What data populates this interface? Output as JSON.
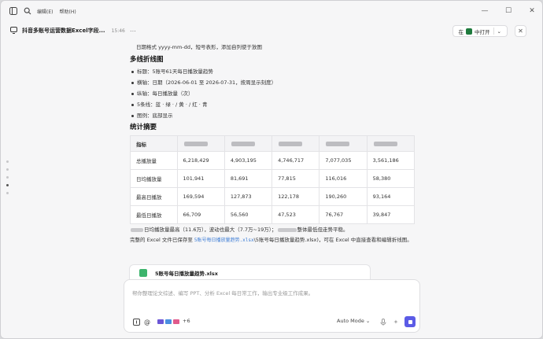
{
  "menu": {
    "edit": "编辑(E)",
    "help": "帮助(H)"
  },
  "chat": {
    "title": "抖音多账号运营数据Excel字段...",
    "time": "15:46",
    "more": "⋯"
  },
  "open_in": {
    "prefix": "在",
    "suffix": "中打开",
    "chevron": "⌄"
  },
  "content": {
    "cut_line": "日期格式 yyyy-mm-dd，短号表形，添加自列使于放图",
    "section_chart": "多线折线图",
    "chart_bullets": [
      "标题：5账号61天每日播放量趋势",
      "横轴：日期（2026-06-01 至 2026-07-31，按周显示刻度）",
      "纵轴：每日播放量（次）",
      "5条线：蓝 · 绿 · / 黄 · / 红 · 青",
      "图例：底部显示"
    ],
    "section_stats": "统计摘要",
    "table_header_first": "指标",
    "table_rows": [
      {
        "label": "总播放量",
        "values": [
          "6,218,429",
          "4,903,195",
          "4,746,717",
          "7,077,035",
          "3,561,186"
        ]
      },
      {
        "label": "日均播放量",
        "values": [
          "101,941",
          "81,691",
          "77,815",
          "116,016",
          "58,380"
        ]
      },
      {
        "label": "最高日播放",
        "values": [
          "169,594",
          "127,873",
          "122,178",
          "190,260",
          "93,164"
        ]
      },
      {
        "label": "最低日播放",
        "values": [
          "66,709",
          "56,560",
          "47,523",
          "76,767",
          "39,847"
        ]
      }
    ],
    "summary_a": "日均播放量最高（11.6万），波动也最大（7.7万~19万）；",
    "summary_b": "整体最低但走势平稳。",
    "saved_prefix": "完整的 Excel 文件已保存至 ",
    "saved_link": "5账号每日播放量趋势.xlsx",
    "saved_middle": "\\5账号每日播放量趋势.xlsx)，可在 Excel 中直接查看和编辑折线图。"
  },
  "file_card": {
    "name": "5账号每日播放量趋势.xlsx"
  },
  "composer": {
    "placeholder": "帮你整理论文综述、编写 PPT、分析 Excel 每日常工作，输出专业级工作成果。",
    "more_tools": "+6",
    "mode": "Auto Mode ⌄"
  },
  "colors": {
    "accent": "#5b5be6",
    "link": "#3a7bd5",
    "excel_green": "#1e7a3d"
  }
}
